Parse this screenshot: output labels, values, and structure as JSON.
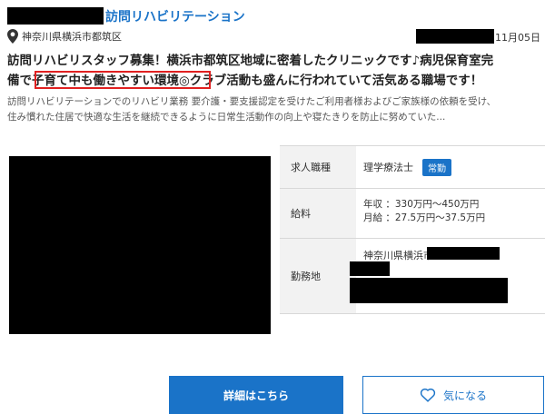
{
  "header": {
    "facility_suffix": "訪問リハビリテーション",
    "location": "神奈川県横浜市都筑区",
    "date": "11月05日"
  },
  "headline": {
    "line1": "訪問リハビリスタッフ募集！横浜市都筑区地域に密着したクリニックです♪病児保育室完",
    "line2": "備で子育て中も働きやすい環境◎クラブ活動も盛んに行われていて活気ある職場です！"
  },
  "description": {
    "line1": "訪問リハビリテーションでのリハビリ業務 要介護・要支援認定を受けたご利用者様およびご家族様の依頼を受け、",
    "line2": "住み慣れた住居で快適な生活を継続できるように日常生活動作の向上や寝たきりを防止に努めていた..."
  },
  "info": {
    "job_label": "求人職種",
    "job_value": "理学療法士",
    "employment_badge": "常勤",
    "salary_label": "給料",
    "salary_annual": "年収 ：330万円〜450万円",
    "salary_monthly": "月給 ：27.5万円〜37.5万円",
    "workplace_label": "勤務地",
    "workplace_address": "神奈川県横浜市"
  },
  "buttons": {
    "detail": "詳細はこちら",
    "favorite": "気になる"
  },
  "colors": {
    "accent": "#1a73c8",
    "highlight_border": "#e02020"
  },
  "icons": {
    "location": "map-pin-icon",
    "favorite": "heart-icon"
  }
}
